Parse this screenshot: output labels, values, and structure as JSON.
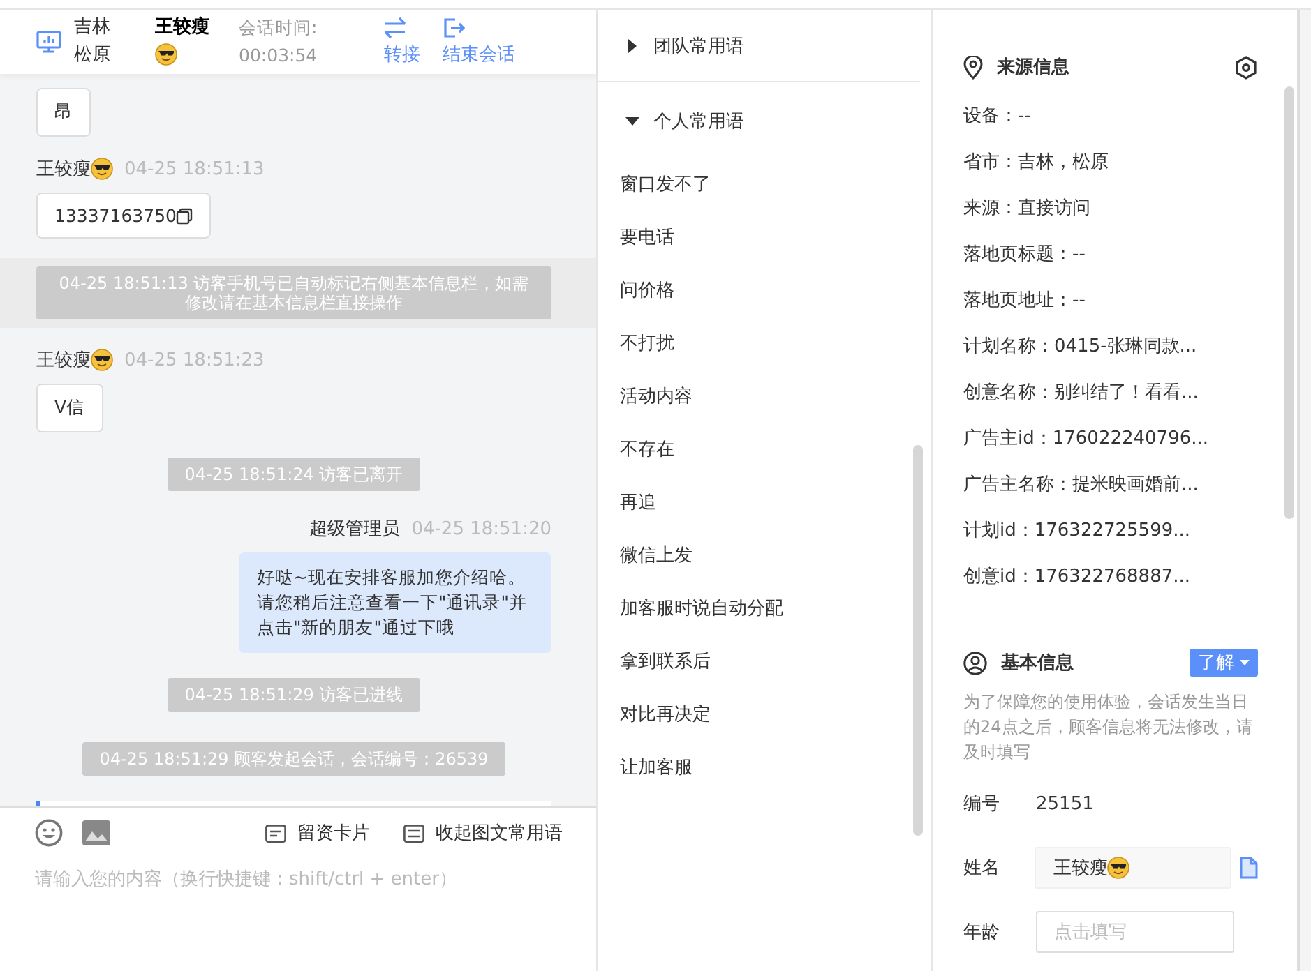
{
  "header": {
    "visitor_location": "吉林松原",
    "visitor_name": "王较瘦",
    "session_time_label": "会话时间:",
    "session_time": "00:03:54",
    "actions": [
      {
        "kind": "transfer",
        "label": "转接"
      },
      {
        "kind": "end",
        "label": "结束会话"
      }
    ]
  },
  "messages": [
    {
      "kind": "visitor",
      "text": "昂"
    },
    {
      "kind": "visitor",
      "sender": "王较瘦",
      "time": "04-25 18:51:13",
      "text": "13337163750",
      "copyable": true
    },
    {
      "kind": "system",
      "text": "04-25 18:51:13 访客手机号已自动标记右侧基本信息栏，如需修改请在基本信息栏直接操作",
      "highlighted": true
    },
    {
      "kind": "visitor",
      "sender": "王较瘦",
      "time": "04-25 18:51:23",
      "text": "V信"
    },
    {
      "kind": "system",
      "text": "04-25 18:51:24 访客已离开",
      "highlighted": false
    },
    {
      "kind": "agent",
      "sender": "超级管理员",
      "time": "04-25 18:51:20",
      "text": "好哒~现在安排客服加您介绍哈。请您稍后注意查看一下\"通讯录\"并点击\"新的朋友\"通过下哦"
    },
    {
      "kind": "system",
      "text": "04-25 18:51:29 访客已进线",
      "highlighted": false
    },
    {
      "kind": "system",
      "text": "04-25 18:51:29 顾客发起会话，会话编号：26539",
      "highlighted": false
    },
    {
      "kind": "card"
    }
  ],
  "composer": {
    "tools": [
      {
        "kind": "card",
        "label": "留资卡片"
      },
      {
        "kind": "collapse",
        "label": "收起图文常用语"
      }
    ],
    "placeholder": "请输入您的内容（换行快捷键：shift/ctrl + enter）"
  },
  "phrases": {
    "groups": [
      {
        "label": "团队常用语",
        "expanded": false
      },
      {
        "label": "个人常用语",
        "expanded": true,
        "items": [
          "窗口发不了",
          "要电话",
          "问价格",
          "不打扰",
          "活动内容",
          "不存在",
          "再追",
          "微信上发",
          "加客服时说自动分配",
          "拿到联系后",
          "对比再决定",
          "让加客服"
        ]
      }
    ]
  },
  "source_info": {
    "title": "来源信息",
    "rows": [
      "设备：--",
      "省市：吉林，松原",
      "来源：直接访问",
      "落地页标题：--",
      "落地页地址：--",
      "计划名称：0415-张琳同款...",
      "创意名称：别纠结了！看看...",
      "广告主id：176022240796...",
      "广告主名称：提米映画婚前...",
      "计划id：176322725599...",
      "创意id：176322768887..."
    ]
  },
  "basic_info": {
    "title": "基本信息",
    "learn_button": "了解",
    "note": "为了保障您的使用体验，会话发生当日的24点之后，顾客信息将无法修改，请及时填写",
    "fields": [
      {
        "kind": "text",
        "label": "编号",
        "value": "25151"
      },
      {
        "kind": "input",
        "label": "姓名",
        "value": "王较瘦"
      },
      {
        "kind": "input",
        "label": "年龄",
        "placeholder": "点击填写"
      }
    ]
  }
}
